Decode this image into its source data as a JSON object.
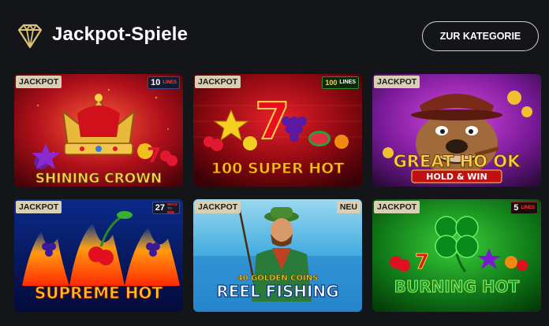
{
  "header": {
    "title": "Jackpot-Spiele",
    "category_button": "ZUR KATEGORIE",
    "icon": "diamond-icon"
  },
  "games": [
    {
      "name": "Shining Crown",
      "logo_text": "SHINING CROWN",
      "badge": "JACKPOT",
      "lines_number": "10",
      "lines_label": "LINES"
    },
    {
      "name": "100 Super Hot",
      "logo_text": "100 SUPER HOT",
      "badge": "JACKPOT",
      "lines_number": "100",
      "lines_label": "LINES"
    },
    {
      "name": "Great Hook",
      "logo_text": "GREAT HO OK",
      "logo_sub": "HOLD & WIN",
      "badge": "JACKPOT"
    },
    {
      "name": "Supreme Hot",
      "logo_text": "SUPREME HOT",
      "badge": "JACKPOT",
      "lines_number": "27",
      "lines_label": "WAYS TO WIN"
    },
    {
      "name": "40 Golden Coins Reel Fishing",
      "logo_top": "40 GOLDEN COINS",
      "logo_text": "REEL FISHING",
      "badge": "JACKPOT",
      "tag": "NEU"
    },
    {
      "name": "Burning Hot",
      "logo_text": "BURNING HOT",
      "badge": "JACKPOT",
      "lines_number": "5",
      "lines_label": "LINES"
    }
  ],
  "colors": {
    "background": "#141519",
    "badge": "#d9d0b3",
    "lines_red": "#ff3b3b"
  }
}
